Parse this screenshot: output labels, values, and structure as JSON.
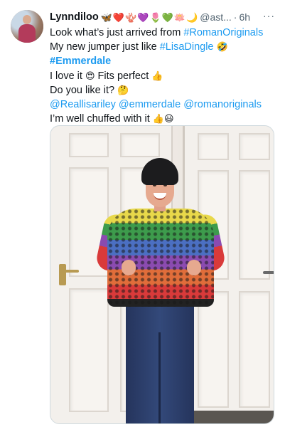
{
  "tweet": {
    "display_name": "Lynndiloo",
    "name_emojis": [
      "🦋",
      "❤️",
      "🪸",
      "💜",
      "🌷",
      "💚",
      "🪷",
      "🌙"
    ],
    "handle": "@ast...",
    "separator": "·",
    "time": "6h",
    "more": "···",
    "lines": [
      {
        "t1": "Look what’s just arrived from ",
        "link1": "#RomanOriginals"
      },
      {
        "t1": "My new jumper just like ",
        "link1": "#LisaDingle",
        "emoji": "🤣"
      },
      {
        "link1": "#Emmerdale"
      },
      {
        "t1": "I love it ",
        "emoji": "😍",
        "t2": " Fits perfect ",
        "emoji2": "👍"
      },
      {
        "t1": "Do you like it? ",
        "emoji": "🤔"
      },
      {
        "link1": "@Reallisariley",
        "sp1": " ",
        "link2": "@emmerdale",
        "sp2": " ",
        "link3": "@romanoriginals"
      },
      {
        "t1": "I’m well chuffed with it ",
        "emoji": "👍😃"
      }
    ]
  },
  "colors": {
    "link": "#1d9bf0",
    "secondary_text": "#536471",
    "text": "#0f1419"
  }
}
